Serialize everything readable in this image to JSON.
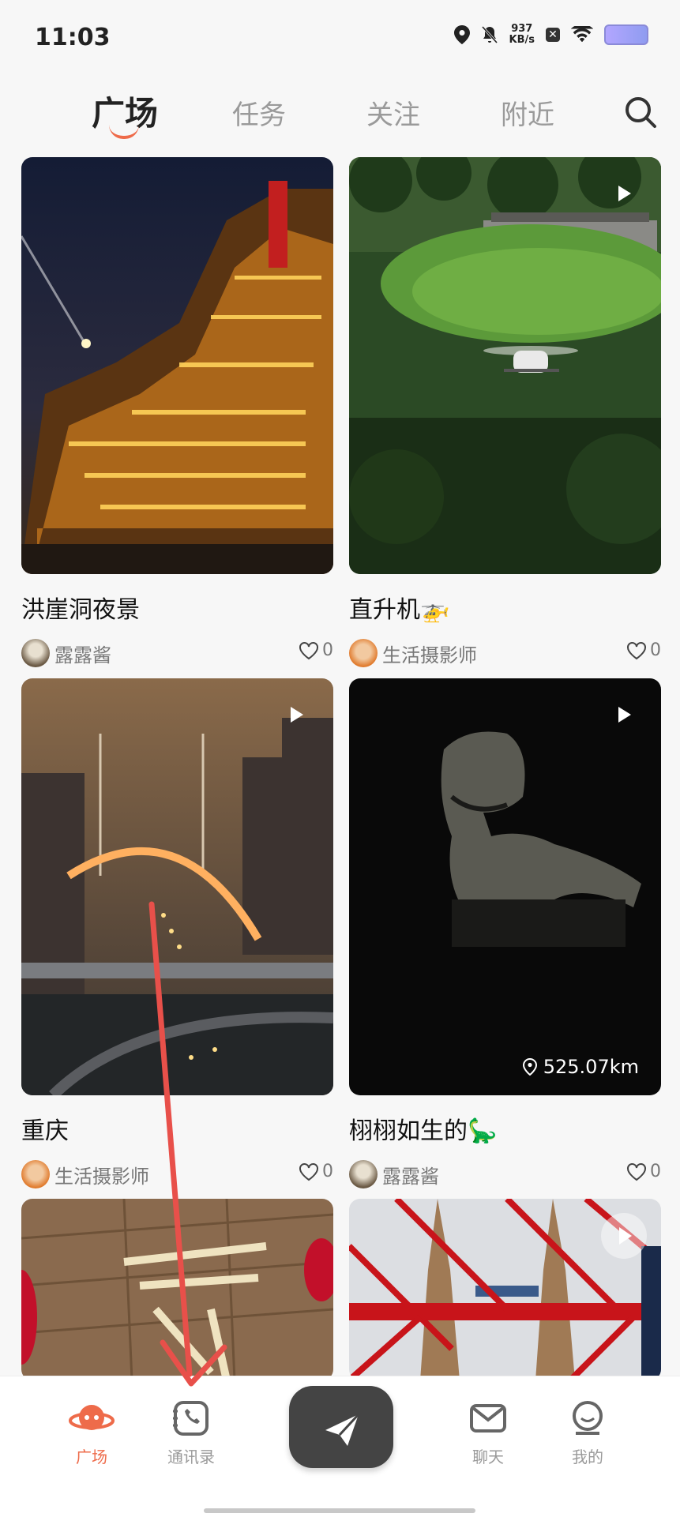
{
  "status_bar": {
    "time": "11:03",
    "speed_value": "937",
    "speed_unit": "KB/s",
    "icons": [
      "location-icon",
      "mute-bell-icon",
      "close-box-icon",
      "wifi-icon",
      "battery-icon"
    ]
  },
  "top_tabs": [
    {
      "label": "广场",
      "active": true
    },
    {
      "label": "任务",
      "active": false
    },
    {
      "label": "关注",
      "active": false
    },
    {
      "label": "附近",
      "active": false
    }
  ],
  "feed": [
    {
      "title": "洪崖洞夜景",
      "author": "露露酱",
      "likes": "0",
      "video": false
    },
    {
      "title": "直升机🚁",
      "author": "生活摄影师",
      "likes": "0",
      "video": true
    },
    {
      "title": "重庆",
      "author": "生活摄影师",
      "likes": "0",
      "video": true
    },
    {
      "title": "栩栩如生的🦕",
      "author": "露露酱",
      "likes": "0",
      "video": true,
      "distance": "525.07km"
    },
    {
      "title": "",
      "author": "",
      "likes": "",
      "video": false
    },
    {
      "title": "",
      "author": "",
      "likes": "",
      "video": true
    }
  ],
  "bottom_nav": [
    {
      "label": "广场",
      "icon": "planet-face-icon",
      "active": true
    },
    {
      "label": "通讯录",
      "icon": "contacts-phone-icon",
      "active": false
    },
    {
      "label": "",
      "icon": "paper-plane-icon",
      "active": false
    },
    {
      "label": "聊天",
      "icon": "mail-icon",
      "active": false
    },
    {
      "label": "我的",
      "icon": "user-face-icon",
      "active": false
    }
  ],
  "colors": {
    "accent": "#ee6b4a",
    "background": "#f7f7f7",
    "nav_send": "#444444",
    "annotation_arrow": "#e8504a"
  }
}
